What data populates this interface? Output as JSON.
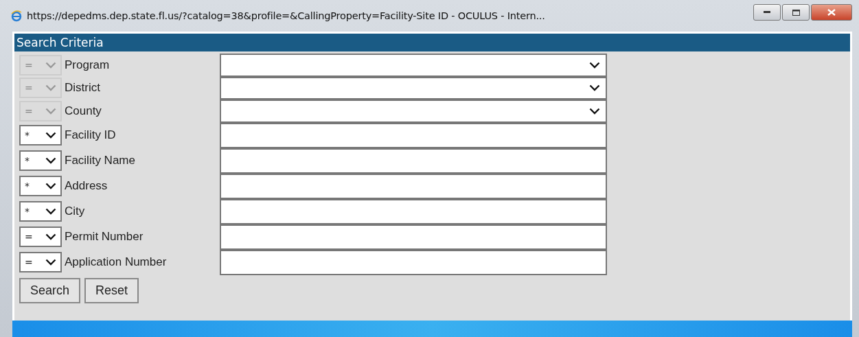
{
  "window": {
    "title": "https://depedms.dep.state.fl.us/?catalog=38&profile=&CallingProperty=Facility-Site ID - OCULUS  - Intern..."
  },
  "panel": {
    "title": "Search Criteria"
  },
  "criteria": [
    {
      "operator": "=",
      "disabled": true,
      "label": "Program",
      "kind": "dropdown"
    },
    {
      "operator": "=",
      "disabled": true,
      "label": "District",
      "kind": "dropdown"
    },
    {
      "operator": "=",
      "disabled": true,
      "label": "County",
      "kind": "dropdown"
    },
    {
      "operator": "*",
      "disabled": false,
      "label": "Facility ID",
      "kind": "text"
    },
    {
      "operator": "*",
      "disabled": false,
      "label": "Facility Name",
      "kind": "text"
    },
    {
      "operator": "*",
      "disabled": false,
      "label": "Address",
      "kind": "text"
    },
    {
      "operator": "*",
      "disabled": false,
      "label": "City",
      "kind": "text"
    },
    {
      "operator": "=",
      "disabled": false,
      "label": "Permit Number",
      "kind": "text"
    },
    {
      "operator": "=",
      "disabled": false,
      "label": "Application Number",
      "kind": "text"
    }
  ],
  "buttons": [
    "Search",
    "Reset"
  ]
}
